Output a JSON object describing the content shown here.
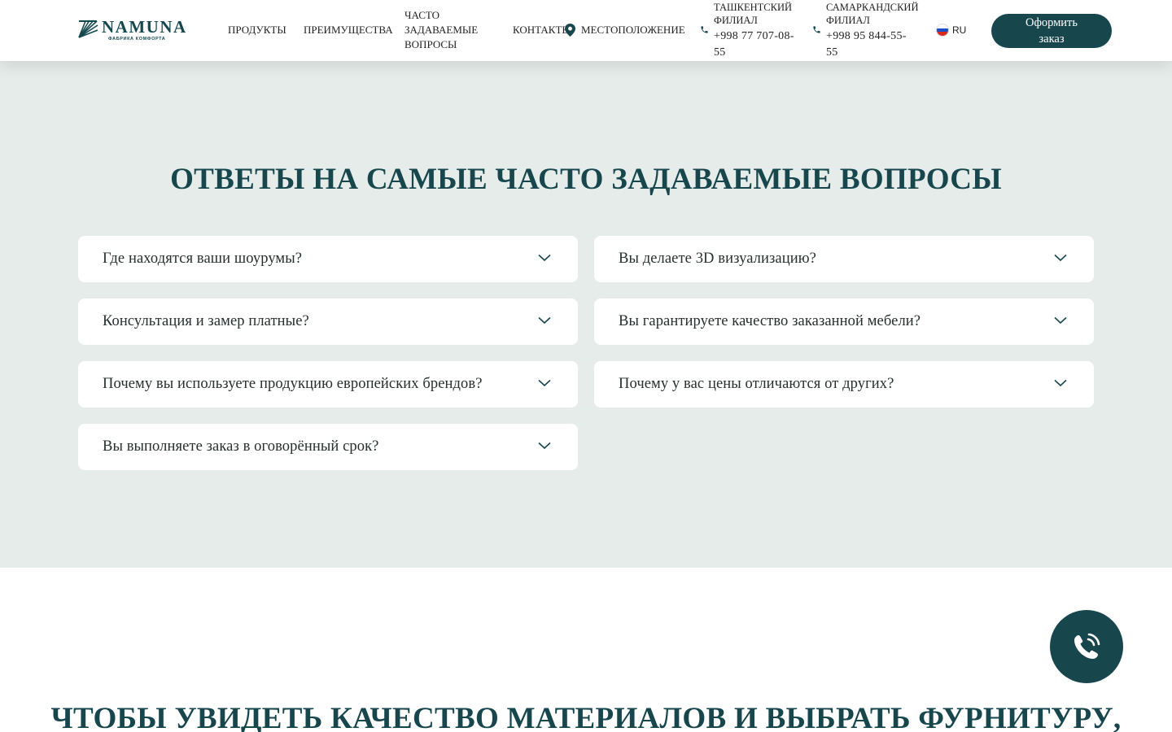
{
  "header": {
    "logo": {
      "name": "NAMUNA",
      "tagline": "ФАБРИКА КОМФОРТА"
    },
    "nav": [
      {
        "label": "ПРОДУКТЫ"
      },
      {
        "label": "ПРЕИМУЩЕСТВА"
      },
      {
        "label": "ЧАСТО ЗАДАВАЕМЫЕ ВОПРОСЫ"
      },
      {
        "label": "КОНТАКТЫ"
      },
      {
        "label": "МЕСТОПОЛОЖЕНИЕ",
        "icon": "map-pin-icon"
      }
    ],
    "phones": [
      {
        "label": "ТАШКЕНТСКИЙ ФИЛИАЛ",
        "number": "+998 77 707-08-55",
        "icon": "phone-icon"
      },
      {
        "label": "САМАРКАНДСКИЙ ФИЛИАЛ",
        "number": "+998 95 844-55-55",
        "icon": "phone-icon"
      }
    ],
    "language": {
      "code": "RU",
      "flag": "russia-flag-icon"
    },
    "order_button": "Оформить заказ"
  },
  "faq": {
    "title_regular": "ОТВЕТЫ НА САМЫЕ",
    "title_bold": "ЧАСТО ЗАДАВАЕМЫЕ ВОПРОСЫ",
    "items": [
      {
        "question": "Где находятся ваши шоурумы?"
      },
      {
        "question": "Вы делаете 3D визуализацию?"
      },
      {
        "question": "Консультация и замер платные?"
      },
      {
        "question": "Вы гарантируете качество заказанной мебели?"
      },
      {
        "question": "Почему вы используете продукцию европейских брендов?"
      },
      {
        "question": "Почему у вас цены отличаются от других?"
      },
      {
        "question": "Вы выполняете заказ в оговорённый срок?"
      }
    ]
  },
  "next_section": {
    "title_regular": "ЧТОБЫ УВИДЕТЬ КАЧЕСТВО МАТЕРИАЛОВ И",
    "title_bold": "ВЫБРАТЬ ФУРНИТУРУ",
    "title_tail": ","
  },
  "call_button": {
    "icon": "phone-call-icon"
  },
  "colors": {
    "brand": "#17474d",
    "section_background": "#e5ecea",
    "card_background": "#ffffff"
  }
}
